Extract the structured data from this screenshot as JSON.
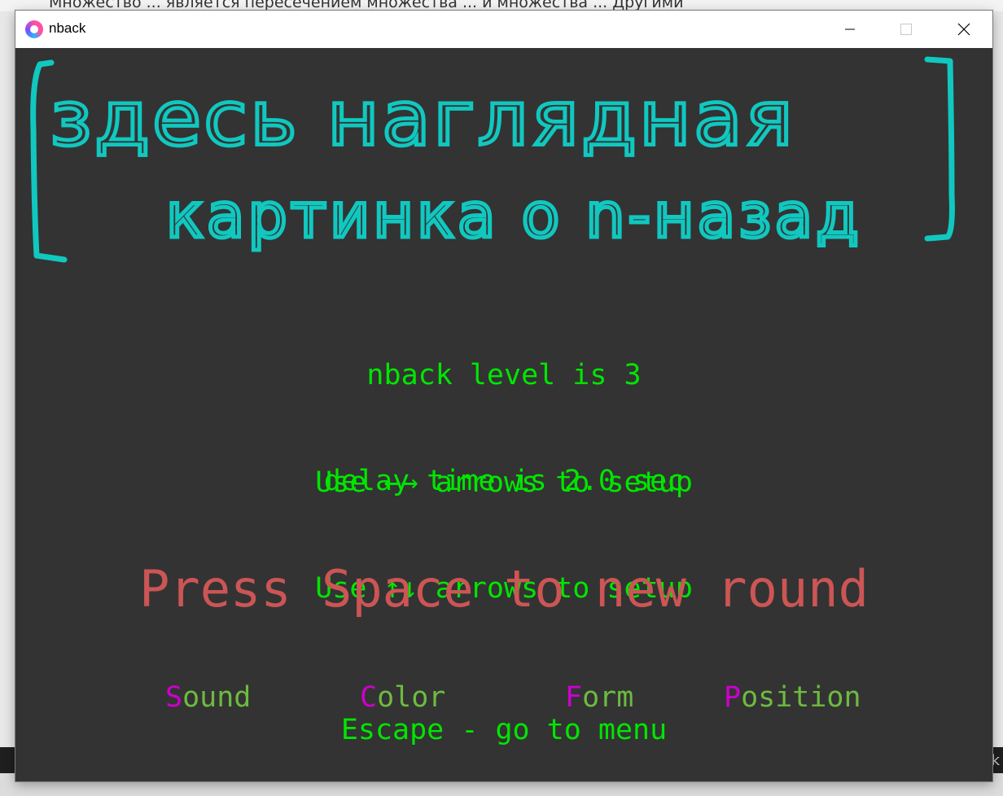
{
  "background": {
    "top_text": "Множество ... является пересечением множества ... и множества ... Другими",
    "bottom_right_char": "k"
  },
  "window": {
    "title": "nback",
    "icon": "app-logo-icon",
    "controls": [
      "minimize-icon",
      "maximize-icon",
      "close-icon"
    ]
  },
  "annotation": {
    "line1": "здесь наглядная",
    "line2": "картинка о n-назад",
    "color": "#10c8c0"
  },
  "settings": {
    "level_line": "nback level is 3",
    "level_hint": "Use ←→ arrows to setup",
    "delay_line": "delay time is 2.0 sec",
    "delay_hint": "Use ↑↓ arrows to setup"
  },
  "prompt": "Press Space to new round",
  "modes": [
    {
      "key": "S",
      "rest": "ound"
    },
    {
      "key": "C",
      "rest": "olor"
    },
    {
      "key": "F",
      "rest": "orm"
    },
    {
      "key": "P",
      "rest": "osition"
    }
  ],
  "escape": "Escape - go to menu",
  "colors": {
    "window_bg": "#333333",
    "info_text": "#00e600",
    "prompt_text": "#cc5555",
    "mode_text": "#6dbb3f",
    "mode_key": "#cc00cc"
  }
}
